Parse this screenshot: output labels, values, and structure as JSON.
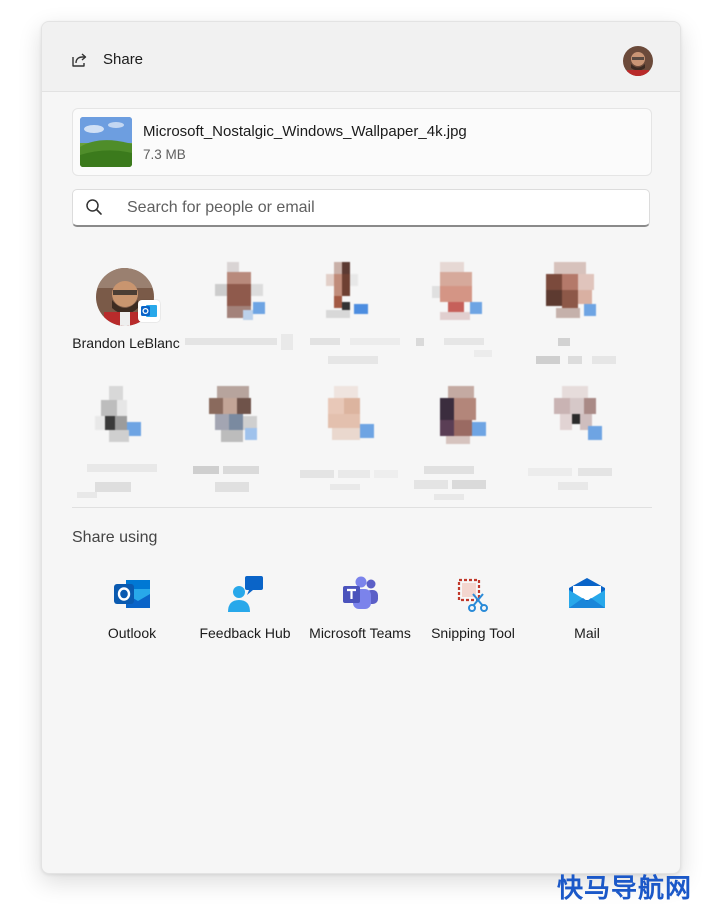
{
  "header": {
    "title": "Share"
  },
  "file": {
    "name": "Microsoft_Nostalgic_Windows_Wallpaper_4k.jpg",
    "size": "7.3 MB"
  },
  "search": {
    "placeholder": "Search for people or email"
  },
  "people": [
    {
      "name": "Brandon LeBlanc"
    }
  ],
  "share_using": {
    "label": "Share using",
    "apps": [
      {
        "label": "Outlook",
        "icon": "outlook-icon"
      },
      {
        "label": "Feedback Hub",
        "icon": "feedback-hub-icon"
      },
      {
        "label": "Microsoft Teams",
        "icon": "teams-icon"
      },
      {
        "label": "Snipping Tool",
        "icon": "snipping-tool-icon"
      },
      {
        "label": "Mail",
        "icon": "mail-icon"
      }
    ]
  },
  "watermark": "快马导航网",
  "colors": {
    "accent": "#0f6cbd",
    "outlook": "#0a64c8",
    "teams": "#5b5fc7",
    "snip": "#c0392b",
    "mail": "#1a86d9"
  }
}
